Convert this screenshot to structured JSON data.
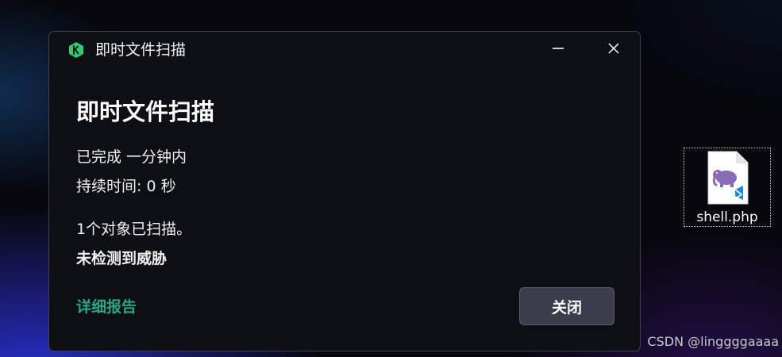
{
  "dialog": {
    "window_title": "即时文件扫描",
    "heading": "即时文件扫描",
    "completed": "已完成 一分钟内",
    "duration": "持续时间: 0 秒",
    "scanned": "1个对象已扫描。",
    "result": "未检测到威胁",
    "details_link": "详细报告",
    "close_button": "关闭",
    "app_icon": "kaspersky-k-icon",
    "minimize_icon": "minimize-icon",
    "close_icon": "close-icon"
  },
  "desktop": {
    "file_name": "shell.php",
    "file_icon": "php-file-icon"
  },
  "watermark": "CSDN @linggggaaaa",
  "colors": {
    "dialog_bg": "#0e0f15",
    "accent_green": "#22a884",
    "app_icon_green": "#2ecc71",
    "button_bg": "#3b3e4a",
    "php_purple": "#8a6bb8",
    "vscode_blue": "#1e88e5"
  }
}
